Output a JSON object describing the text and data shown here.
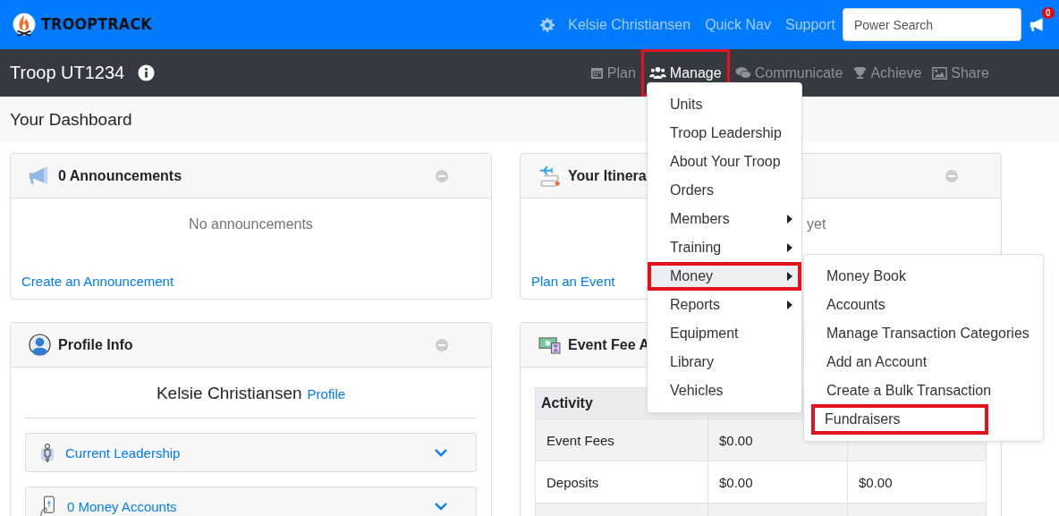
{
  "brand": {
    "name": "TROOPTRACK"
  },
  "top_nav": {
    "links": [
      "Kelsie Christiansen",
      "Quick Nav",
      "Support"
    ],
    "search": {
      "placeholder": "Power Search"
    },
    "notification_count": "0"
  },
  "unit_bar": {
    "title": "Troop UT1234",
    "tabs": [
      {
        "label": "Plan",
        "selected": false,
        "highlighted": false
      },
      {
        "label": "Manage",
        "selected": true,
        "highlighted": true
      },
      {
        "label": "Communicate",
        "selected": false,
        "highlighted": false
      },
      {
        "label": "Achieve",
        "selected": false,
        "highlighted": false
      },
      {
        "label": "Share",
        "selected": false,
        "highlighted": false
      }
    ]
  },
  "page_title": "Your Dashboard",
  "announcements": {
    "title": "0 Announcements",
    "empty_text": "No announcements",
    "link": "Create an Announcement"
  },
  "itinerary": {
    "title": "Your Itinera",
    "text": "yet",
    "link": "Plan an Event"
  },
  "profile": {
    "title": "Profile Info",
    "name": "Kelsie Christiansen",
    "link": "Profile",
    "sections": [
      {
        "label": "Current Leadership"
      },
      {
        "label": "0 Money Accounts"
      }
    ]
  },
  "event_fees": {
    "title": "Event Fee A",
    "columns": [
      "Activity"
    ],
    "rows": [
      {
        "cells": [
          "Event Fees",
          "$0.00"
        ]
      },
      {
        "cells": [
          "Deposits",
          "$0.00",
          "$0.00"
        ]
      }
    ]
  },
  "manage_menu": {
    "items": [
      {
        "label": "Units",
        "submenu": false,
        "selected": false,
        "highlighted": false
      },
      {
        "label": "Troop Leadership",
        "submenu": false,
        "selected": false,
        "highlighted": false
      },
      {
        "label": "About Your Troop",
        "submenu": false,
        "selected": false,
        "highlighted": false
      },
      {
        "label": "Orders",
        "submenu": false,
        "selected": false,
        "highlighted": false
      },
      {
        "label": "Members",
        "submenu": true,
        "selected": false,
        "highlighted": false
      },
      {
        "label": "Training",
        "submenu": true,
        "selected": false,
        "highlighted": false
      },
      {
        "label": "Money",
        "submenu": true,
        "selected": true,
        "highlighted": true
      },
      {
        "label": "Reports",
        "submenu": true,
        "selected": false,
        "highlighted": false
      },
      {
        "label": "Equipment",
        "submenu": false,
        "selected": false,
        "highlighted": false
      },
      {
        "label": "Library",
        "submenu": false,
        "selected": false,
        "highlighted": false
      },
      {
        "label": "Vehicles",
        "submenu": false,
        "selected": false,
        "highlighted": false
      }
    ]
  },
  "money_menu": {
    "items": [
      {
        "label": "Money Book",
        "highlighted": false
      },
      {
        "label": "Accounts",
        "highlighted": false
      },
      {
        "label": "Manage Transaction Categories",
        "highlighted": false
      },
      {
        "label": "Add an Account",
        "highlighted": false
      },
      {
        "label": "Create a Bulk Transaction",
        "highlighted": false
      },
      {
        "label": "Fundraisers",
        "highlighted": true
      }
    ]
  }
}
